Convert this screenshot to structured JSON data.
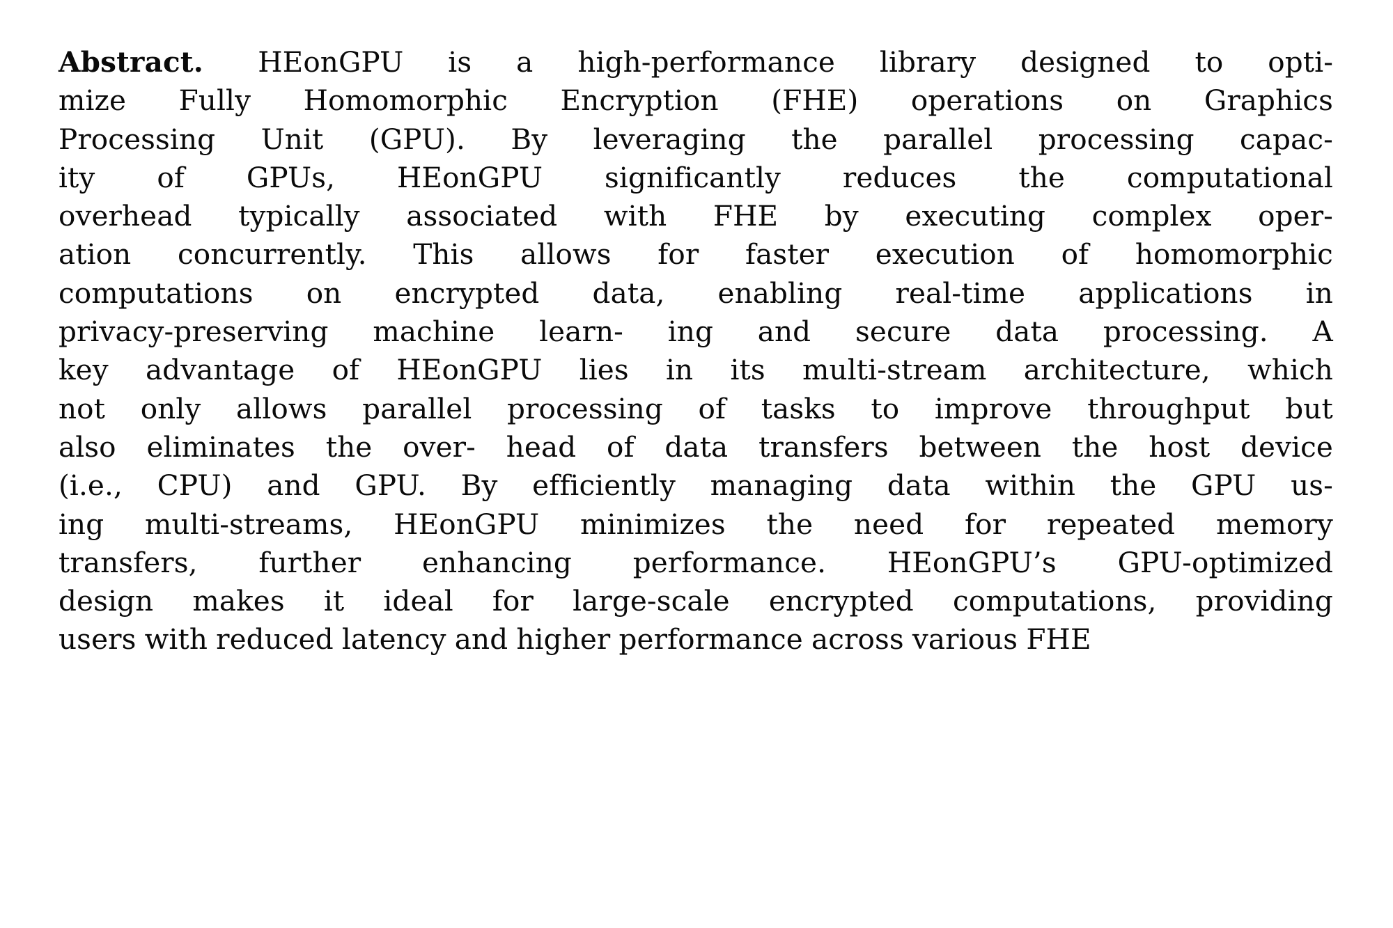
{
  "document": {
    "type": "paper-abstract",
    "page_background": "#ffffff",
    "text_color": "#0a0a0a",
    "label": "Abstract.",
    "alignment": "justified",
    "full_text": "Abstract. HEonGPU is a high-performance library designed to optimize Fully Homomorphic Encryption (FHE) operations on Graphics Processing Unit (GPU). By leveraging the parallel processing capacity of GPUs, HEonGPU significantly reduces the computational overhead typically associated with FHE by executing complex operation concurrently. This allows for faster execution of homomorphic computations on encrypted data, enabling real-time applications in privacy-preserving machine learn- ing and secure data processing. A key advantage of HEonGPU lies in its multi-stream architecture, which not only allows parallel processing of tasks to improve throughput but also eliminates the over- head of data transfers between the host device (i.e., CPU) and GPU. By efficiently managing data within the GPU using multi-streams, HEonGPU minimizes the need for repeated memory transfers, further enhancing performance. HEonGPU's GPU-optimized design makes it ideal for large-scale encrypted computations, providing users with reduced latency and higher performance across various FHE",
    "lines": [
      "HEonGPU is a high-performance library designed to opti-",
      "mize Fully Homomorphic Encryption (FHE) operations on Graphics",
      "Processing Unit (GPU). By leveraging the parallel processing capac-",
      "ity of GPUs, HEonGPU significantly reduces the computational",
      "overhead typically associated with FHE by executing complex oper-",
      "ation concurrently. This allows for faster execution of homomorphic",
      "computations on encrypted data, enabling real-time applications in",
      "privacy-preserving machine learn- ing and secure data processing. A",
      "key advantage of HEonGPU lies in its multi-stream architecture, which",
      "not only allows parallel processing of tasks to improve throughput but",
      "also eliminates the over- head of data transfers between the host device",
      "(i.e., CPU) and GPU. By efficiently managing data within the GPU us-",
      "ing multi-streams, HEonGPU minimizes the need for repeated memory",
      "transfers, further enhancing performance. HEonGPU’s GPU-optimized",
      "design makes it ideal for large-scale encrypted computations, providing",
      "users with reduced latency and higher performance across various FHE"
    ]
  }
}
